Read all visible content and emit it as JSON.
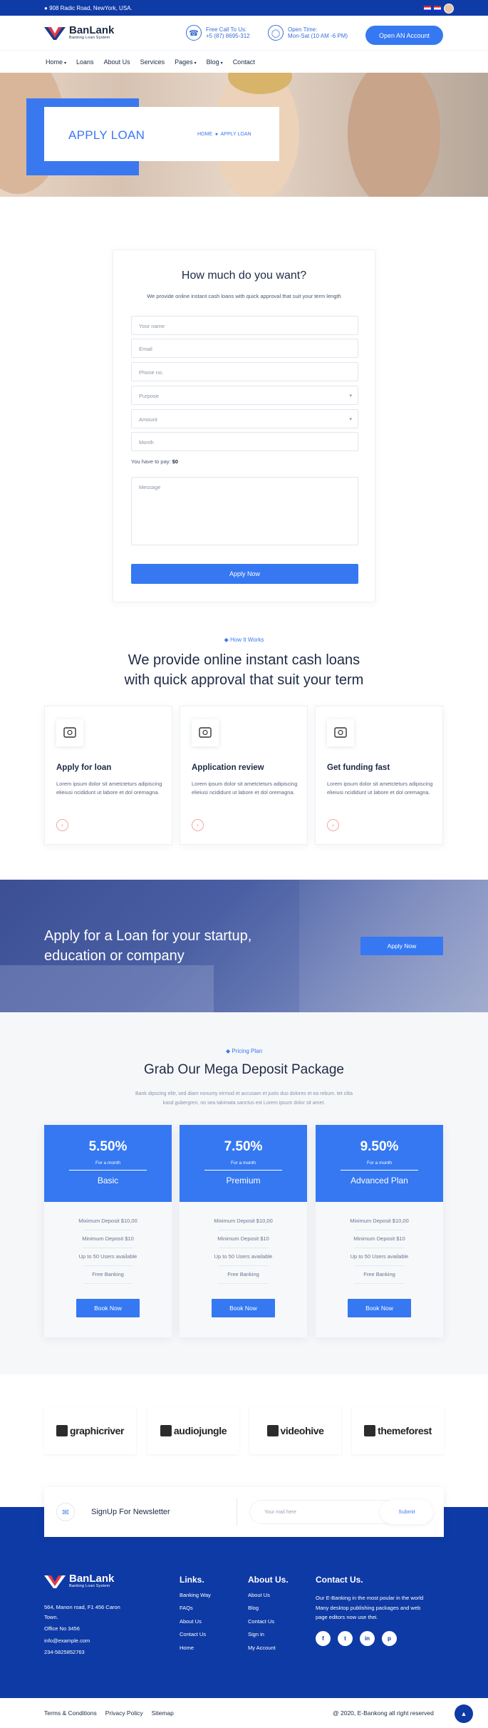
{
  "topbar": {
    "address": "908 Radic Road, NewYork, USA."
  },
  "header": {
    "brand": "BanLank",
    "tagline": "Banking Loan System",
    "call_label": "Free Call To Us:",
    "call_value": "+5 (87) 8695-312",
    "time_label": "Open Time:",
    "time_value": "Mon-Sat (10 AM -6 PM)",
    "cta": "Open AN Account"
  },
  "nav": [
    {
      "label": "Home",
      "dropdown": true
    },
    {
      "label": "Loans",
      "dropdown": false
    },
    {
      "label": "About Us",
      "dropdown": false
    },
    {
      "label": "Services",
      "dropdown": false
    },
    {
      "label": "Pages",
      "dropdown": true
    },
    {
      "label": "Blog",
      "dropdown": true
    },
    {
      "label": "Contact",
      "dropdown": false
    }
  ],
  "hero": {
    "title": "APPLY LOAN",
    "crumb_home": "HOME",
    "crumb_current": "APPLY LOAN"
  },
  "form": {
    "heading": "How much do you want?",
    "subtitle": "We provide online instant cash loans with quick approval that suit your term length",
    "name_placeholder": "Your name",
    "email_placeholder": "Email",
    "phone_placeholder": "Phone no.",
    "purpose_select": "Purpose",
    "amount_select": "Amount",
    "month_placeholder": "Month",
    "pay_label": "You have to pay:",
    "pay_value": "$0",
    "message_placeholder": "Message",
    "submit": "Apply Now"
  },
  "how": {
    "eyebrow": "How It Works",
    "line1": "We provide online instant cash loans",
    "line2": "with quick approval that suit your term",
    "steps": [
      {
        "icon": "credit-card-icon",
        "title": "Apply for loan",
        "text": "Lorem ipsum dolor sit ametcteturs adipiscing elieiusi ncididunt ut labore et dol oremagna."
      },
      {
        "icon": "globe-review-icon",
        "title": "Application review",
        "text": "Lorem ipsum dolor sit ametcteturs adipiscing elieiusi ncididunt ut labore et dol oremagna."
      },
      {
        "icon": "laptop-dollar-icon",
        "title": "Get funding fast",
        "text": "Lorem ipsum dolor sit ametcteturs adipiscing elieiusi ncididunt ut labore et dol oremagna."
      }
    ]
  },
  "banner": {
    "line1": "Apply for a Loan for your startup,",
    "line2": "education or company",
    "button": "Apply Now"
  },
  "pricing": {
    "eyebrow": "Pricing Plan",
    "heading": "Grab Our Mega Deposit Package",
    "text1": "Bank dipscing elitr, sed diam nonumy eirmod et accusam et justo duo dolores et ea rebum. tet clita",
    "text2": "kasd gubergren, no sea takimata sanctus est Lorem ipsum dolor sit amet.",
    "plans": [
      {
        "rate": "5.50%",
        "period": "For a month",
        "name": "Basic",
        "features": [
          "Miximum Deposit $10,00",
          "Minimum Deposit $10",
          "Up to 50 Users available",
          "Free Banking"
        ],
        "button": "Book Now"
      },
      {
        "rate": "7.50%",
        "period": "For a month",
        "name": "Premium",
        "features": [
          "Miximum Deposit $10,00",
          "Minimum Deposit $10",
          "Up to 50 Users available",
          "Free Banking"
        ],
        "button": "Book Now"
      },
      {
        "rate": "9.50%",
        "period": "For a month",
        "name": "Advanced Plan",
        "features": [
          "Miximum Deposit $10,00",
          "Minimum Deposit $10",
          "Up to 50 Users available",
          "Free Banking"
        ],
        "button": "Book Now"
      }
    ]
  },
  "brands": [
    "graphicriver",
    "audiojungle",
    "videohive",
    "themeforest"
  ],
  "newsletter": {
    "title": "SignUp For Newsletter",
    "placeholder": "Your mail here",
    "button": "Submit"
  },
  "footer": {
    "brand": "BanLank",
    "tagline": "Banking Loan System",
    "address1": "564, Manon road, F1 456 Caron",
    "address2": "Town.",
    "office": "Office No 3456",
    "email": "info@example.com",
    "phone": "234-5825852763",
    "links_title": "Links.",
    "links": [
      "Banking Way",
      "FAQs",
      "About Us",
      "Contact Us",
      "Home"
    ],
    "about_title": "About Us.",
    "about_links": [
      "About Us",
      "Blog",
      "Contact Us",
      "Sign in",
      "My Account"
    ],
    "contact_title": "Contact Us.",
    "contact_text1": "Our E-Banking in the most poular in the world",
    "contact_text2": "Many desktop publishing packages and web",
    "contact_text3": "page editors now use thei.",
    "social": [
      {
        "icon": "facebook-icon",
        "glyph": "f"
      },
      {
        "icon": "twitter-icon",
        "glyph": "t"
      },
      {
        "icon": "linkedin-icon",
        "glyph": "in"
      },
      {
        "icon": "pinterest-icon",
        "glyph": "p"
      }
    ]
  },
  "copyright": {
    "terms": "Terms & Conditions",
    "privacy": "Privacy Policy",
    "sitemap": "Sitemap",
    "text": "@ 2020, E-Bankong all right reserved"
  },
  "colors": {
    "primary": "#3578f2",
    "navy": "#0e3aa5",
    "accent_red": "#f08080"
  }
}
